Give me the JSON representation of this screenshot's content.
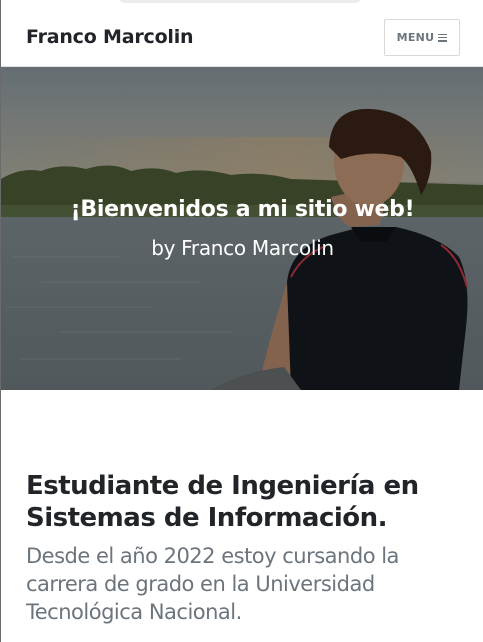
{
  "navbar": {
    "brand": "Franco Marcolin",
    "menu_label": "MENU",
    "menu_icon": "bars-icon"
  },
  "hero": {
    "title": "¡Bienvenidos a mi sitio web!",
    "subtitle": "by Franco Marcolin"
  },
  "main": {
    "heading": "Estudiante de Ingeniería en Sistemas de Información.",
    "paragraph": "Desde el año 2022 estoy cursando la carrera de grado en la Universidad Tecnológica Nacional."
  }
}
